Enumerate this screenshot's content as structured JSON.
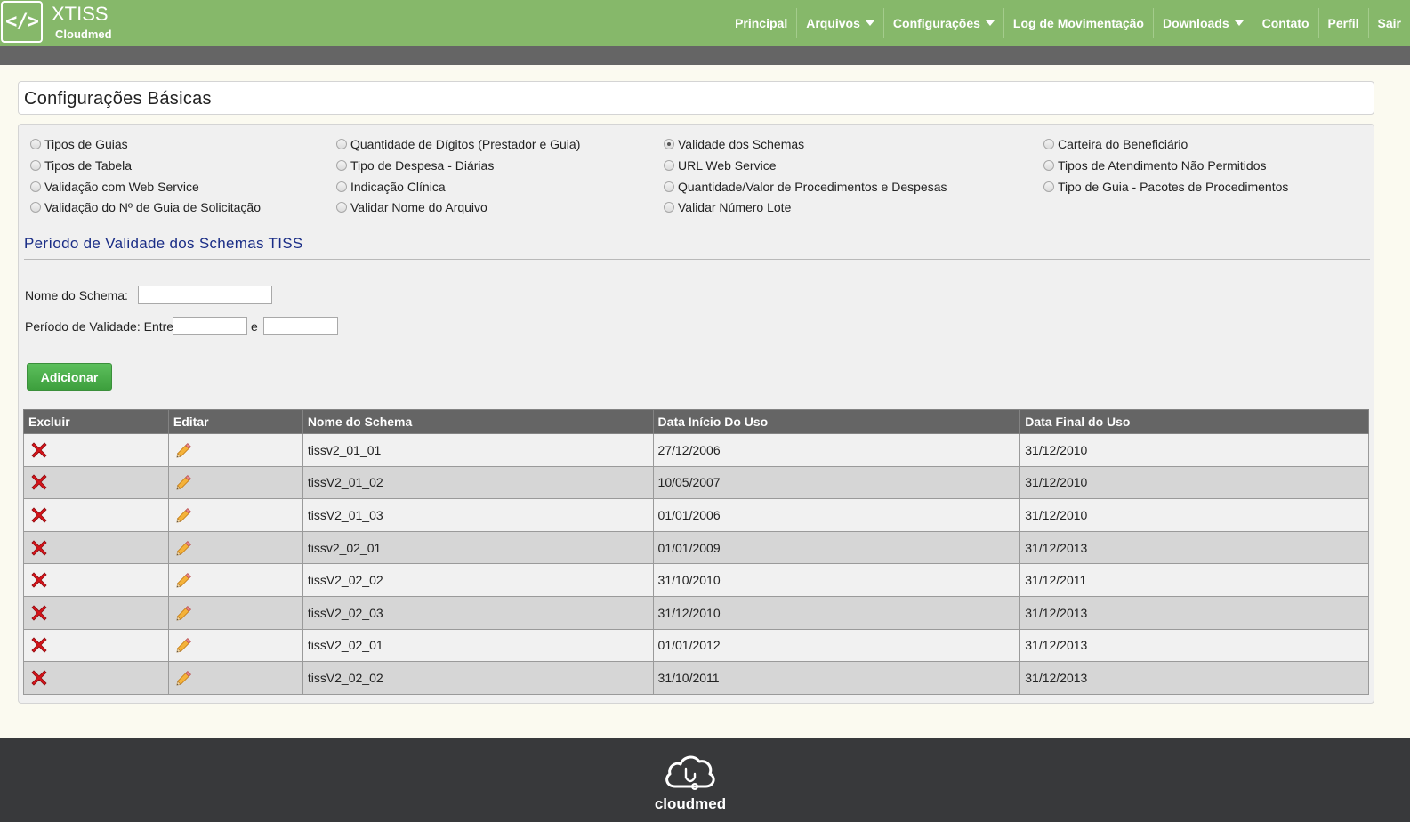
{
  "brand": {
    "logo": "</>",
    "name": "XTISS",
    "sub": "Cloudmed"
  },
  "nav": [
    {
      "label": "Principal",
      "dropdown": false
    },
    {
      "label": "Arquivos",
      "dropdown": true
    },
    {
      "label": "Configurações",
      "dropdown": true
    },
    {
      "label": "Log de Movimentação",
      "dropdown": false
    },
    {
      "label": "Downloads",
      "dropdown": true
    },
    {
      "label": "Contato",
      "dropdown": false
    },
    {
      "label": "Perfil",
      "dropdown": false
    },
    {
      "label": "Sair",
      "dropdown": false
    }
  ],
  "page_title": "Configurações Básicas",
  "options": {
    "col1": [
      "Tipos de Guias",
      "Tipos de Tabela",
      "Validação com Web Service",
      "Validação do Nº de Guia de Solicitação"
    ],
    "col2": [
      "Quantidade de Dígitos (Prestador e Guia)",
      "Tipo de Despesa - Diárias",
      "Indicação Clínica",
      "Validar Nome do Arquivo"
    ],
    "col3": [
      "Validade dos Schemas",
      "URL Web Service",
      "Quantidade/Valor de Procedimentos e Despesas",
      "Validar Número Lote"
    ],
    "col4": [
      "Carteira do Beneficiário",
      "Tipos de Atendimento Não Permitidos",
      "Tipo de Guia - Pacotes de Procedimentos"
    ],
    "selected": "Validade dos Schemas"
  },
  "section": {
    "title": "Período de Validade dos Schemas TISS",
    "schema_label": "Nome do Schema:",
    "schema_value": "",
    "period_label": "Período de Validade: Entre",
    "period_sep": "e",
    "period_start": "",
    "period_end": "",
    "add_button": "Adicionar"
  },
  "table": {
    "headers": [
      "Excluir",
      "Editar",
      "Nome do Schema",
      "Data Início Do Uso",
      "Data Final do Uso"
    ],
    "rows": [
      {
        "name": "tissv2_01_01",
        "start": "27/12/2006",
        "end": "31/12/2010"
      },
      {
        "name": "tissV2_01_02",
        "start": "10/05/2007",
        "end": "31/12/2010"
      },
      {
        "name": "tissV2_01_03",
        "start": "01/01/2006",
        "end": "31/12/2010"
      },
      {
        "name": "tissv2_02_01",
        "start": "01/01/2009",
        "end": "31/12/2013"
      },
      {
        "name": "tissV2_02_02",
        "start": "31/10/2010",
        "end": "31/12/2011"
      },
      {
        "name": "tissV2_02_03",
        "start": "31/12/2010",
        "end": "31/12/2013"
      },
      {
        "name": "tissV2_02_01",
        "start": "01/01/2012",
        "end": "31/12/2013"
      },
      {
        "name": "tissV2_02_02",
        "start": "31/10/2011",
        "end": "31/12/2013"
      }
    ],
    "delete_icon": "delete-x-icon",
    "edit_icon": "pencil-icon"
  },
  "footer": {
    "logo_text": "cloudmed",
    "logo_icon": "cloud-icon"
  },
  "colors": {
    "header": "#86b86a",
    "subbar": "#656565",
    "section_title": "#1a2d86",
    "add_button": "#4caf50",
    "delete": "#d7141a",
    "footer": "#38393b"
  }
}
